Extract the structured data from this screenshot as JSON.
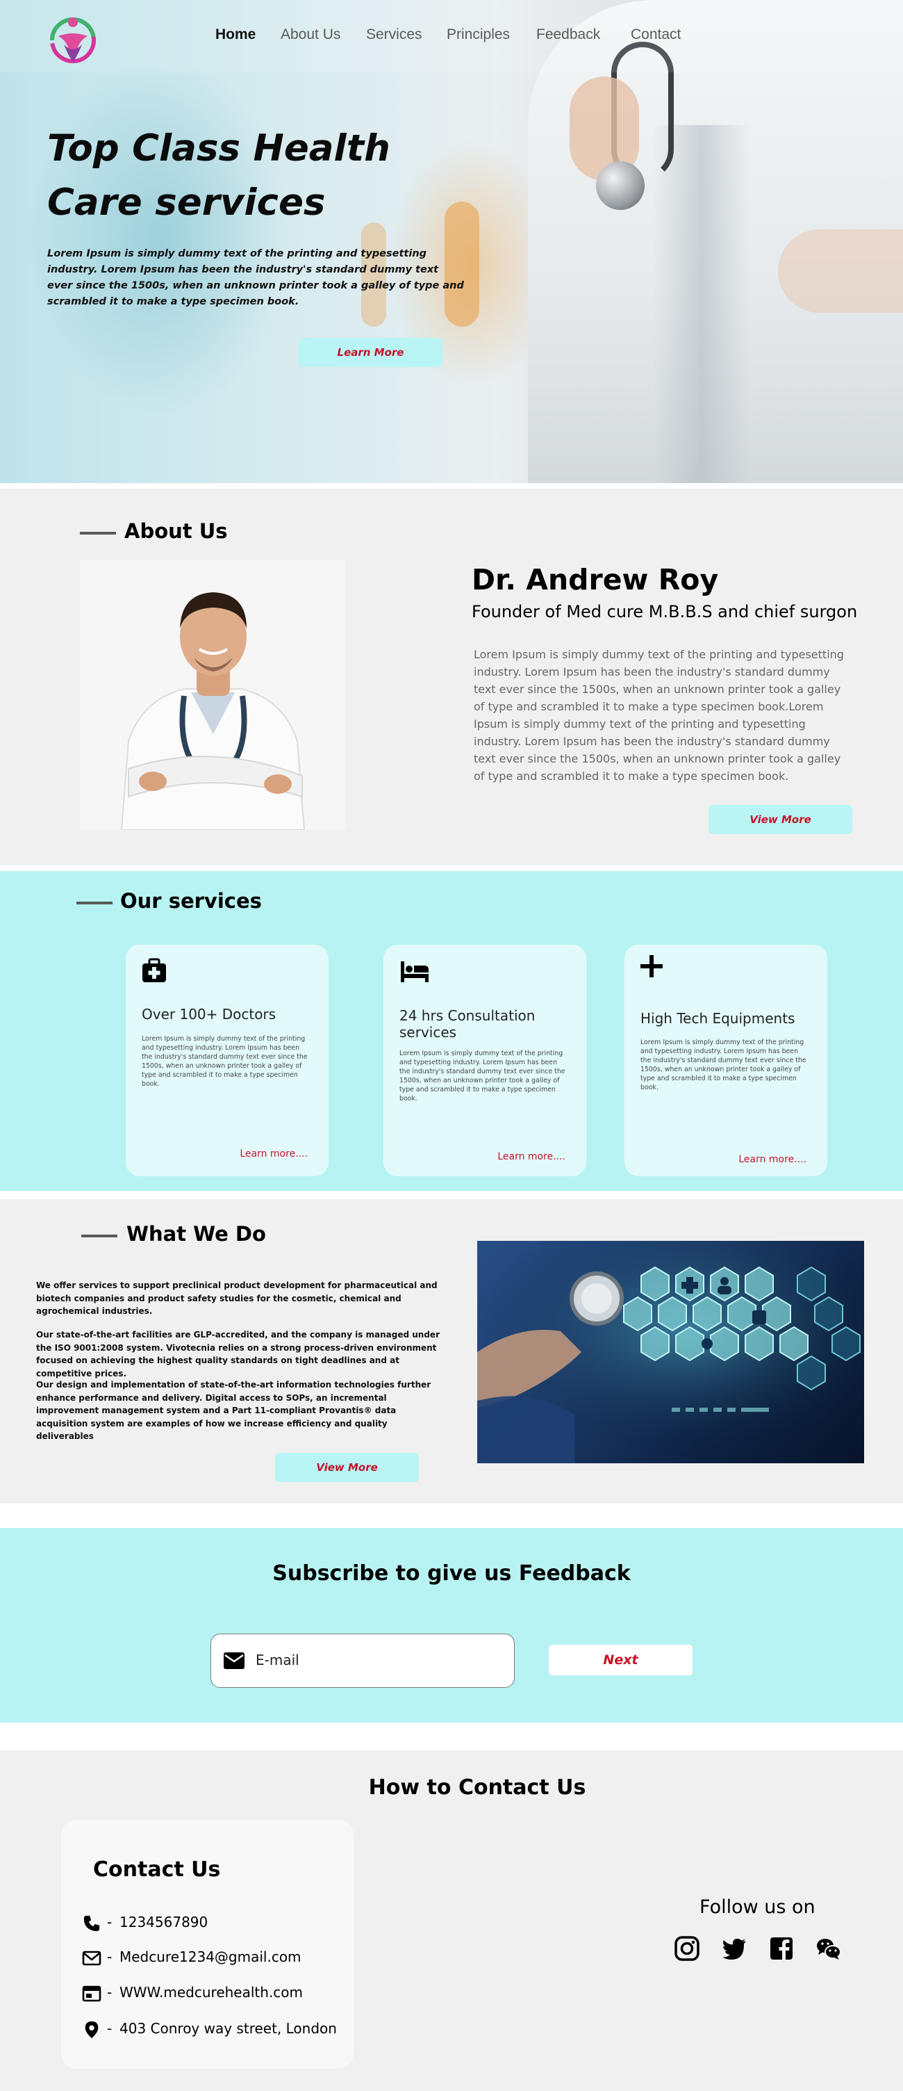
{
  "nav": {
    "items": [
      {
        "label": "Home",
        "active": true
      },
      {
        "label": "About Us",
        "active": false
      },
      {
        "label": "Services",
        "active": false
      },
      {
        "label": "Principles",
        "active": false
      },
      {
        "label": "Feedback",
        "active": false
      },
      {
        "label": "Contact",
        "active": false
      }
    ]
  },
  "hero": {
    "title": "Top Class Health Care services",
    "text": "Lorem Ipsum is simply dummy text of the printing and typesetting industry. Lorem Ipsum has been the industry's standard dummy text ever since the 1500s, when an unknown printer took a galley of type and scrambled it to make a type specimen book.",
    "button_label": "Learn More"
  },
  "about": {
    "section_title": "About Us",
    "doctor_name": "Dr. Andrew Roy",
    "doctor_role": "Founder of Med cure M.B.B.S and chief surgon",
    "bio": "Lorem Ipsum is simply dummy text of the printing and typesetting industry. Lorem Ipsum has been the industry's standard dummy text ever since the 1500s, when an unknown printer took a galley of type and scrambled it to make a type specimen book.Lorem Ipsum is simply dummy text of the printing and typesetting industry. Lorem Ipsum has been the industry's standard dummy text ever since the 1500s, when an unknown printer took a galley of type and scrambled it to make a type specimen book.",
    "button_label": "View More"
  },
  "services": {
    "section_title": "Our services",
    "cards": [
      {
        "icon": "medical-kit-icon",
        "title": "Over 100+ Doctors",
        "text": "Lorem Ipsum is simply dummy text of the printing and typesetting industry. Lorem Ipsum has been the industry's standard dummy text ever since the 1500s, when an unknown printer took a galley of type and scrambled it to make a type specimen book.",
        "link": "Learn more...."
      },
      {
        "icon": "hospital-bed-icon",
        "title": "24 hrs Consultation services",
        "text": "Lorem Ipsum is simply dummy text of the printing and typesetting industry. Lorem Ipsum has been the industry's standard dummy text ever since the 1500s, when an unknown printer took a galley of type and scrambled it to make a type specimen book.",
        "link": "Learn more...."
      },
      {
        "icon": "plus-icon",
        "title": "High Tech Equipments",
        "text": "Lorem Ipsum is simply dummy text of the printing and typesetting industry. Lorem Ipsum has been the industry's standard dummy text ever since the 1500s, when an unknown printer took a galley of type and scrambled it to make a type specimen book.",
        "link": "Learn more...."
      }
    ]
  },
  "what_we_do": {
    "section_title": "What We Do",
    "paragraphs": [
      "We offer services to support preclinical product development for pharmaceutical and biotech companies and product safety studies for the cosmetic, chemical and agrochemical industries.",
      "Our state-of-the-art facilities are GLP-accredited, and the company is managed under the ISO 9001:2008 system. Vivotecnia relies on a strong process-driven environment focused on achieving the highest quality standards on tight deadlines and at competitive prices.",
      "Our design and implementation of state-of-the-art information technologies further enhance performance and delivery. Digital access to SOPs, an incremental improvement management system and a Part 11-compliant Provantis® data acquisition system are examples of how we increase efficiency and quality deliverables"
    ],
    "button_label": "View More"
  },
  "subscribe": {
    "title": "Subscribe to give us Feedback",
    "email_placeholder": "E-mail",
    "button_label": "Next"
  },
  "contact": {
    "section_title": "How to Contact Us",
    "card_title": "Contact Us",
    "rows": [
      {
        "icon": "phone-icon",
        "value": "1234567890"
      },
      {
        "icon": "mail-icon",
        "value": "Medcure1234@gmail.com"
      },
      {
        "icon": "website-icon",
        "value": "WWW.medcurehealth.com"
      },
      {
        "icon": "location-pin-icon",
        "value": "403 Conroy way street, London"
      }
    ],
    "separator": "-",
    "follow_label": "Follow us on",
    "social": [
      "instagram-icon",
      "twitter-icon",
      "facebook-icon",
      "wechat-icon"
    ]
  },
  "colors": {
    "accent_cyan": "#b7f3f2",
    "button_cyan": "#b9f5f4",
    "link_red": "#c4142b",
    "section_gray": "#f0f0f0"
  }
}
